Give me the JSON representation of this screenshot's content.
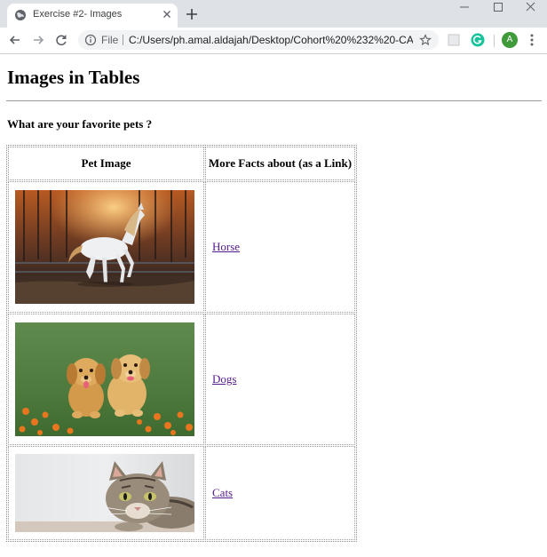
{
  "browser": {
    "tab_title": "Exercise #2- Images",
    "url_prefix": "File",
    "url": "C:/Users/ph.amal.aldajah/Desktop/Cohort%20%232%20-CA/E...",
    "avatar_letter": "A"
  },
  "page": {
    "title": "Images in Tables",
    "question": "What are your favorite pets ?"
  },
  "table": {
    "headers": [
      "Pet Image",
      "More Facts about (as a Link)"
    ],
    "rows": [
      {
        "image": "horse",
        "link": "Horse"
      },
      {
        "image": "dogs",
        "link": "Dogs"
      },
      {
        "image": "cats",
        "link": "Cats"
      }
    ]
  },
  "colors": {
    "chrome": "#dee1e6",
    "visited_link": "#551a8b",
    "avatar": "#3f9a3a",
    "grammarly": "#15c39a"
  }
}
